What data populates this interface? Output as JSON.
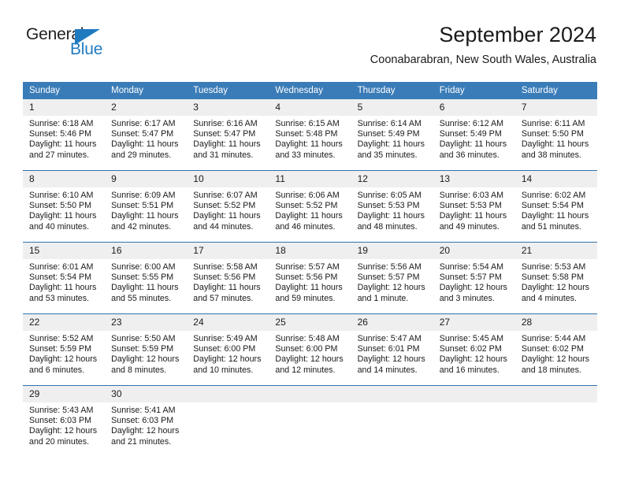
{
  "brand": {
    "name_line1": "General",
    "name_line2": "Blue",
    "triangle_color": "#1f7ac0"
  },
  "header": {
    "title": "September 2024",
    "subtitle": "Coonabarabran, New South Wales, Australia",
    "accent_color": "#3a7cb8",
    "day_band_color": "#efefef"
  },
  "weekday_headers": [
    "Sunday",
    "Monday",
    "Tuesday",
    "Wednesday",
    "Thursday",
    "Friday",
    "Saturday"
  ],
  "weeks": [
    [
      {
        "day": "1",
        "sunrise": "Sunrise: 6:18 AM",
        "sunset": "Sunset: 5:46 PM",
        "daylight": "Daylight: 11 hours and 27 minutes."
      },
      {
        "day": "2",
        "sunrise": "Sunrise: 6:17 AM",
        "sunset": "Sunset: 5:47 PM",
        "daylight": "Daylight: 11 hours and 29 minutes."
      },
      {
        "day": "3",
        "sunrise": "Sunrise: 6:16 AM",
        "sunset": "Sunset: 5:47 PM",
        "daylight": "Daylight: 11 hours and 31 minutes."
      },
      {
        "day": "4",
        "sunrise": "Sunrise: 6:15 AM",
        "sunset": "Sunset: 5:48 PM",
        "daylight": "Daylight: 11 hours and 33 minutes."
      },
      {
        "day": "5",
        "sunrise": "Sunrise: 6:14 AM",
        "sunset": "Sunset: 5:49 PM",
        "daylight": "Daylight: 11 hours and 35 minutes."
      },
      {
        "day": "6",
        "sunrise": "Sunrise: 6:12 AM",
        "sunset": "Sunset: 5:49 PM",
        "daylight": "Daylight: 11 hours and 36 minutes."
      },
      {
        "day": "7",
        "sunrise": "Sunrise: 6:11 AM",
        "sunset": "Sunset: 5:50 PM",
        "daylight": "Daylight: 11 hours and 38 minutes."
      }
    ],
    [
      {
        "day": "8",
        "sunrise": "Sunrise: 6:10 AM",
        "sunset": "Sunset: 5:50 PM",
        "daylight": "Daylight: 11 hours and 40 minutes."
      },
      {
        "day": "9",
        "sunrise": "Sunrise: 6:09 AM",
        "sunset": "Sunset: 5:51 PM",
        "daylight": "Daylight: 11 hours and 42 minutes."
      },
      {
        "day": "10",
        "sunrise": "Sunrise: 6:07 AM",
        "sunset": "Sunset: 5:52 PM",
        "daylight": "Daylight: 11 hours and 44 minutes."
      },
      {
        "day": "11",
        "sunrise": "Sunrise: 6:06 AM",
        "sunset": "Sunset: 5:52 PM",
        "daylight": "Daylight: 11 hours and 46 minutes."
      },
      {
        "day": "12",
        "sunrise": "Sunrise: 6:05 AM",
        "sunset": "Sunset: 5:53 PM",
        "daylight": "Daylight: 11 hours and 48 minutes."
      },
      {
        "day": "13",
        "sunrise": "Sunrise: 6:03 AM",
        "sunset": "Sunset: 5:53 PM",
        "daylight": "Daylight: 11 hours and 49 minutes."
      },
      {
        "day": "14",
        "sunrise": "Sunrise: 6:02 AM",
        "sunset": "Sunset: 5:54 PM",
        "daylight": "Daylight: 11 hours and 51 minutes."
      }
    ],
    [
      {
        "day": "15",
        "sunrise": "Sunrise: 6:01 AM",
        "sunset": "Sunset: 5:54 PM",
        "daylight": "Daylight: 11 hours and 53 minutes."
      },
      {
        "day": "16",
        "sunrise": "Sunrise: 6:00 AM",
        "sunset": "Sunset: 5:55 PM",
        "daylight": "Daylight: 11 hours and 55 minutes."
      },
      {
        "day": "17",
        "sunrise": "Sunrise: 5:58 AM",
        "sunset": "Sunset: 5:56 PM",
        "daylight": "Daylight: 11 hours and 57 minutes."
      },
      {
        "day": "18",
        "sunrise": "Sunrise: 5:57 AM",
        "sunset": "Sunset: 5:56 PM",
        "daylight": "Daylight: 11 hours and 59 minutes."
      },
      {
        "day": "19",
        "sunrise": "Sunrise: 5:56 AM",
        "sunset": "Sunset: 5:57 PM",
        "daylight": "Daylight: 12 hours and 1 minute."
      },
      {
        "day": "20",
        "sunrise": "Sunrise: 5:54 AM",
        "sunset": "Sunset: 5:57 PM",
        "daylight": "Daylight: 12 hours and 3 minutes."
      },
      {
        "day": "21",
        "sunrise": "Sunrise: 5:53 AM",
        "sunset": "Sunset: 5:58 PM",
        "daylight": "Daylight: 12 hours and 4 minutes."
      }
    ],
    [
      {
        "day": "22",
        "sunrise": "Sunrise: 5:52 AM",
        "sunset": "Sunset: 5:59 PM",
        "daylight": "Daylight: 12 hours and 6 minutes."
      },
      {
        "day": "23",
        "sunrise": "Sunrise: 5:50 AM",
        "sunset": "Sunset: 5:59 PM",
        "daylight": "Daylight: 12 hours and 8 minutes."
      },
      {
        "day": "24",
        "sunrise": "Sunrise: 5:49 AM",
        "sunset": "Sunset: 6:00 PM",
        "daylight": "Daylight: 12 hours and 10 minutes."
      },
      {
        "day": "25",
        "sunrise": "Sunrise: 5:48 AM",
        "sunset": "Sunset: 6:00 PM",
        "daylight": "Daylight: 12 hours and 12 minutes."
      },
      {
        "day": "26",
        "sunrise": "Sunrise: 5:47 AM",
        "sunset": "Sunset: 6:01 PM",
        "daylight": "Daylight: 12 hours and 14 minutes."
      },
      {
        "day": "27",
        "sunrise": "Sunrise: 5:45 AM",
        "sunset": "Sunset: 6:02 PM",
        "daylight": "Daylight: 12 hours and 16 minutes."
      },
      {
        "day": "28",
        "sunrise": "Sunrise: 5:44 AM",
        "sunset": "Sunset: 6:02 PM",
        "daylight": "Daylight: 12 hours and 18 minutes."
      }
    ],
    [
      {
        "day": "29",
        "sunrise": "Sunrise: 5:43 AM",
        "sunset": "Sunset: 6:03 PM",
        "daylight": "Daylight: 12 hours and 20 minutes."
      },
      {
        "day": "30",
        "sunrise": "Sunrise: 5:41 AM",
        "sunset": "Sunset: 6:03 PM",
        "daylight": "Daylight: 12 hours and 21 minutes."
      },
      {
        "day": "",
        "sunrise": "",
        "sunset": "",
        "daylight": ""
      },
      {
        "day": "",
        "sunrise": "",
        "sunset": "",
        "daylight": ""
      },
      {
        "day": "",
        "sunrise": "",
        "sunset": "",
        "daylight": ""
      },
      {
        "day": "",
        "sunrise": "",
        "sunset": "",
        "daylight": ""
      },
      {
        "day": "",
        "sunrise": "",
        "sunset": "",
        "daylight": ""
      }
    ]
  ]
}
